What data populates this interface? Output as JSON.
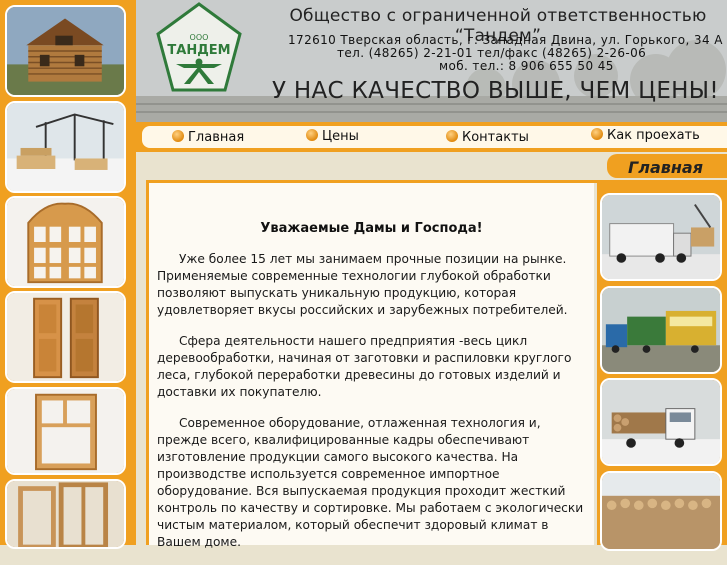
{
  "header": {
    "company_name": "Общество с ограниченной ответственностью “Тандем”",
    "address": "172610 Тверская область, г. Западная Двина, ул. Горького, 34 А",
    "phones": "тел. (48265) 2-21-01 тел/факс (48265) 2-26-06",
    "mobile": "моб. тел.: 8 906 655 50 45",
    "slogan": "У НАС КАЧЕСТВО ВЫШЕ, ЧЕМ ЦЕНЫ!",
    "logo_top": "ООО",
    "logo_name": "ТАНДЕМ"
  },
  "nav": {
    "items": [
      {
        "label": "Главная"
      },
      {
        "label": "Цены"
      },
      {
        "label": "Контакты"
      },
      {
        "label": "Как проехать"
      }
    ]
  },
  "section": {
    "title": "Главная"
  },
  "content": {
    "heading": "Уважаемые Дамы и Господа!",
    "paragraphs": [
      "Уже более 15 лет мы занимаем прочные позиции на рынке. Применяемые современные технологии глубокой обработки позволяют выпускать уникальную продукцию, которая удовлетворяет вкусы российских и зарубежных потребителей.",
      "Сфера деятельности нашего предприятия  -весь цикл деревообработки, начиная от заготовки и распиловки круглого леса, глубокой переработки древесины до готовых изделий и доставки их покупателю.",
      "Современное оборудование, отлаженная технология и, прежде всего, квалифицированные кадры обеспечивают изготовление продукции самого высокого качества. На производстве используется современное импортное оборудование. Вся выпускаемая продукция проходит жесткий контроль по качеству и сортировке. Мы работаем с экологически чистым материалом, который обеспечит здоровый климат в Вашем доме."
    ]
  },
  "colors": {
    "accent": "#f0a020",
    "logo_green": "#2f7a3a"
  },
  "left_photos": [
    "log-house-photo",
    "lumber-yard-photo",
    "arched-window-photo",
    "wooden-door-photo",
    "window-frame-photo",
    "door-frames-photo"
  ],
  "right_photos": [
    "truck-loading-photo",
    "trucks-yard-photo",
    "timber-truck-photo",
    "logs-pile-photo"
  ]
}
